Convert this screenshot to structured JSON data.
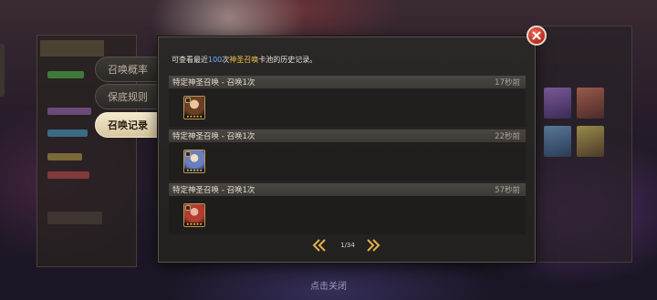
{
  "side_tabs": [
    {
      "label": "召唤概率",
      "active": false
    },
    {
      "label": "保底规则",
      "active": false
    },
    {
      "label": "召唤记录",
      "active": true
    }
  ],
  "dialog": {
    "info": {
      "prefix": "可查看最近",
      "count": "100",
      "unit": "次",
      "pool": "神圣召唤",
      "suffix": "卡池的历史记录。"
    },
    "records": [
      {
        "title": "特定神圣召唤 - 召唤1次",
        "time": "17秒前",
        "hero_icon": "hero-portrait-icon"
      },
      {
        "title": "特定神圣召唤 - 召唤1次",
        "time": "22秒前",
        "hero_icon": "hero-portrait-icon"
      },
      {
        "title": "特定神圣召唤 - 召唤1次",
        "time": "57秒前",
        "hero_icon": "hero-portrait-icon"
      }
    ],
    "pagination": {
      "label": "1/34",
      "current": 1,
      "total": 34
    }
  },
  "close_hint": "点击关闭",
  "colors": {
    "accent_blue": "#6cb2ff",
    "accent_gold": "#f2c14a",
    "close_red": "#c8362a"
  }
}
